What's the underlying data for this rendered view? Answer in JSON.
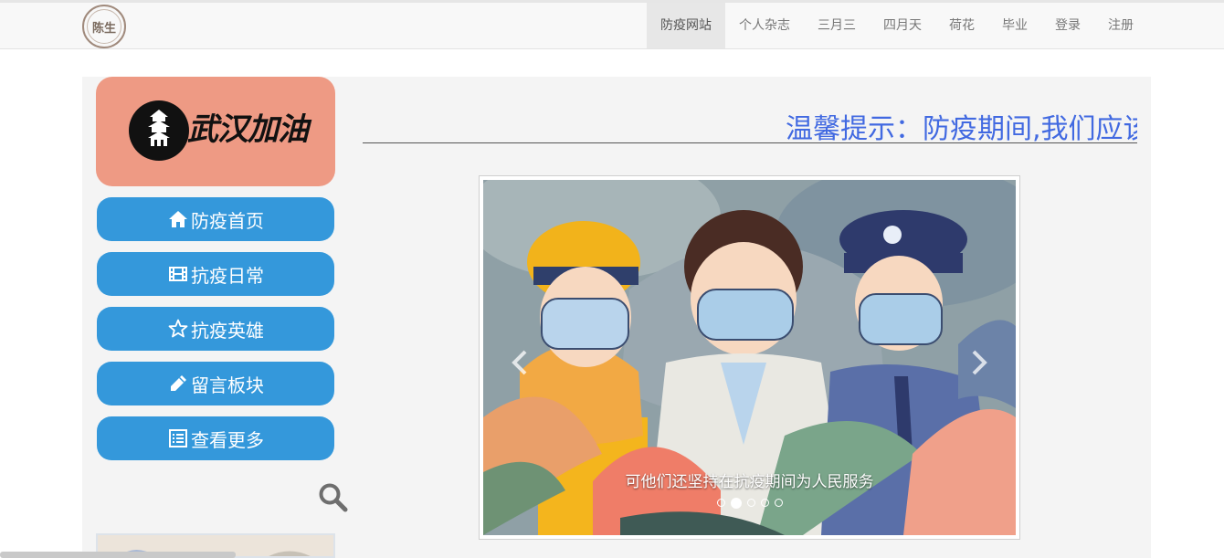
{
  "brand": {
    "logo_text": "陈生"
  },
  "nav": {
    "items": [
      {
        "label": "防疫网站",
        "active": true
      },
      {
        "label": "个人杂志"
      },
      {
        "label": "三月三"
      },
      {
        "label": "四月天"
      },
      {
        "label": "荷花"
      },
      {
        "label": "毕业"
      },
      {
        "label": "登录"
      },
      {
        "label": "注册"
      }
    ]
  },
  "banner": {
    "text": "武汉加油"
  },
  "sidebar": {
    "items": [
      {
        "label": "防疫首页",
        "icon": "home-icon"
      },
      {
        "label": "抗疫日常",
        "icon": "film-icon"
      },
      {
        "label": "抗疫英雄",
        "icon": "star-icon"
      },
      {
        "label": "留言板块",
        "icon": "pencil-icon"
      },
      {
        "label": "查看更多",
        "icon": "list-icon"
      }
    ]
  },
  "marquee": {
    "text": "温馨提示：防疫期间,我们应该"
  },
  "carousel": {
    "caption": "可他们还坚持在抗疫期间为人民服务",
    "slide_count": 5,
    "active_index": 1
  },
  "colors": {
    "sidebar_button": "#3498db",
    "banner_bg": "#ee9a84",
    "marquee_text": "#4169e1",
    "nav_active_bg": "#e7e7e7"
  }
}
